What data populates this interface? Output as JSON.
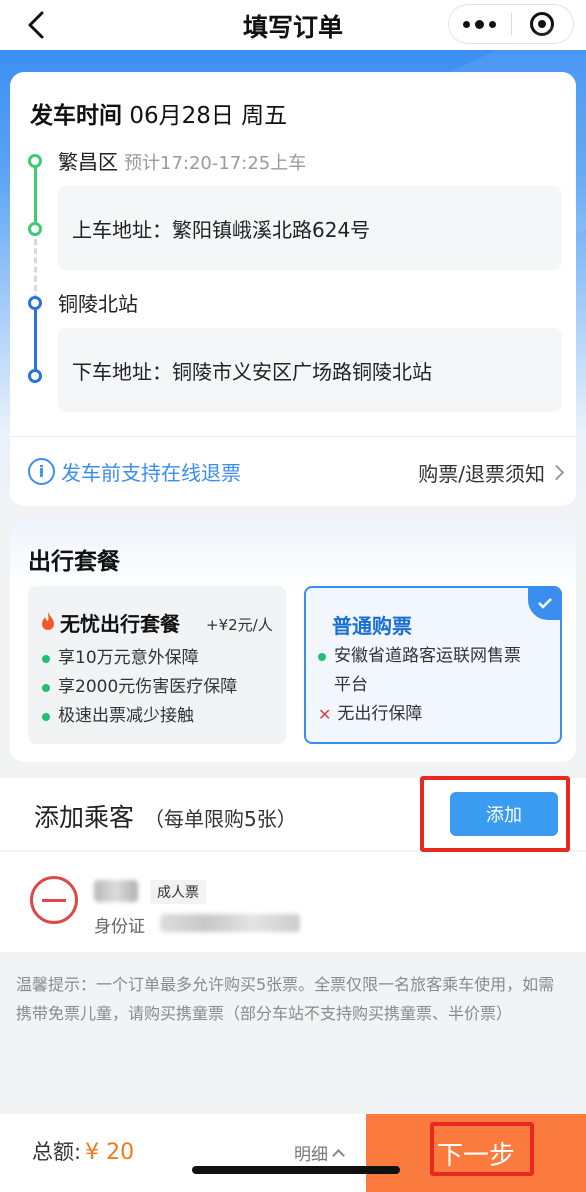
{
  "nav": {
    "title": "填写订单"
  },
  "trip": {
    "departure_label": "发车时间",
    "departure_value": "06月28日 周五",
    "origin": {
      "name": "繁昌区",
      "eta": "预计17:20-17:25上车",
      "address": "上车地址：繁阳镇峨溪北路624号"
    },
    "destination": {
      "name": "铜陵北站",
      "address": "下车地址：铜陵市义安区广场路铜陵北站"
    },
    "refund_text": "发车前支持在线退票",
    "notice_link": "购票/退票须知",
    "colors": {
      "origin": "#3ccc72",
      "destination": "#2a73d8",
      "accent": "#3a8ef0"
    }
  },
  "package": {
    "title": "出行套餐",
    "options": [
      {
        "name": "无忧出行套餐",
        "price": "+¥2元/人",
        "selected": false,
        "features": [
          "享10万元意外保障",
          "享2000元伤害医疗保障",
          "极速出票减少接触"
        ]
      },
      {
        "name": "普通购票",
        "selected": true,
        "features": [
          "安徽省道路客运联网售票",
          "平台"
        ],
        "negative": "无出行保障"
      }
    ]
  },
  "passengers": {
    "title": "添加乘客",
    "limit": "（每单限购5张）",
    "add_label": "添加",
    "items": [
      {
        "ticket_type": "成人票",
        "id_label": "身份证"
      }
    ]
  },
  "tip": "温馨提示：一个订单最多允许购买5张票。全票仅限一名旅客乘车使用，如需携带免票儿童，请购买携童票（部分车站不支持购买携童票、半价票）",
  "footer": {
    "total_label": "总额:",
    "total_amount": "¥ 20",
    "detail_label": "明细",
    "next_label": "下一步",
    "colors": {
      "amount": "#f07a1c",
      "next": "#fb7a3e"
    }
  }
}
